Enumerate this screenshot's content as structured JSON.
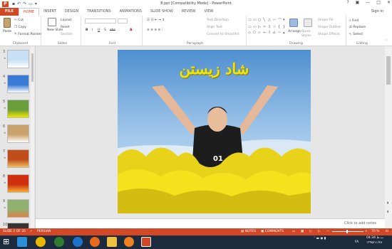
{
  "titlebar": {
    "title": "8.ppt [Compatibility Mode] - PowerPoint",
    "help": "?",
    "min": "—",
    "max": "□",
    "close": "✕"
  },
  "tabs": [
    "FILE",
    "HOME",
    "INSERT",
    "DESIGN",
    "TRANSITIONS",
    "ANIMATIONS",
    "SLIDE SHOW",
    "REVIEW",
    "VIEW"
  ],
  "signin": "Sign in",
  "ribbon": {
    "clipboard": {
      "paste": "Paste",
      "cut": "Cut",
      "copy": "Copy",
      "format_painter": "Format Painter",
      "label": "Clipboard"
    },
    "slides": {
      "new_slide": "New Slide",
      "layout": "Layout",
      "reset": "Reset",
      "section": "Section",
      "label": "Slides"
    },
    "font": {
      "label": "Font",
      "bold": "B",
      "italic": "I",
      "underline": "U",
      "strike": "S",
      "abc": "abc"
    },
    "paragraph": {
      "label": "Paragraph",
      "text_direction": "Text Direction",
      "align_text": "Align Text",
      "smartart": "Convert to SmartArt"
    },
    "drawing": {
      "label": "Drawing",
      "arrange": "Arrange",
      "quick_styles": "Quick Styles",
      "shape_fill": "Shape Fill",
      "shape_outline": "Shape Outline",
      "shape_effects": "Shape Effects"
    },
    "editing": {
      "label": "Editing",
      "find": "Find",
      "replace": "Replace",
      "select": "Select"
    }
  },
  "thumbnails": [
    {
      "num": "3",
      "colors": [
        "#c7e0f4",
        "#ffffff"
      ]
    },
    {
      "num": "4",
      "colors": [
        "#3a7bd5",
        "#ffffff"
      ]
    },
    {
      "num": "5",
      "colors": [
        "#6a9e3a",
        "#f2e600"
      ]
    },
    {
      "num": "6",
      "colors": [
        "#c9a36b",
        "#ffffff"
      ]
    },
    {
      "num": "7",
      "colors": [
        "#c04d1a",
        "#f0c060"
      ]
    },
    {
      "num": "8",
      "colors": [
        "#d03010",
        "#f0b030"
      ]
    },
    {
      "num": "9",
      "colors": [
        "#8fb070",
        "#e08040"
      ]
    },
    {
      "num": "10",
      "colors": [
        "#333333",
        "#dddddd"
      ]
    }
  ],
  "slide": {
    "title": "شاد زیستن",
    "jersey": "01"
  },
  "notes_placeholder": "Click to add notes",
  "status": {
    "slide_of": "SLIDE 2 OF 35",
    "language": "PERSIAN",
    "notes": "NOTES",
    "comments": "COMMENTS",
    "zoom": "70 %"
  },
  "tray": {
    "lang": "FA",
    "time": "04:34 ب.ظ",
    "date": "۱۳۹۵/۱۱/۲۸"
  },
  "colors": {
    "accent": "#d24726",
    "slide_yellow": "#f2e600",
    "taskbar": "#1c2a3e"
  }
}
